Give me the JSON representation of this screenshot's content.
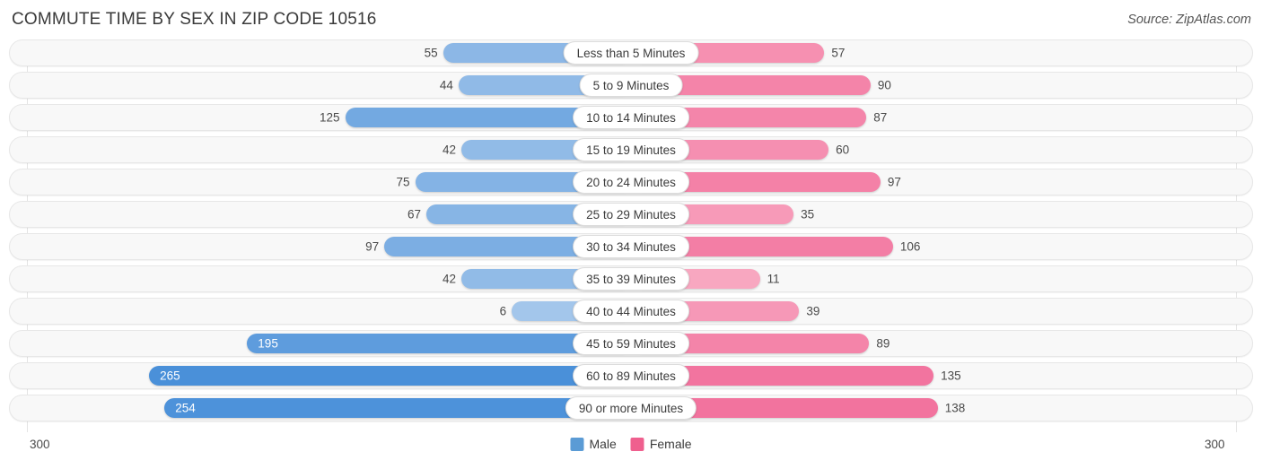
{
  "header": {
    "title": "COMMUTE TIME BY SEX IN ZIP CODE 10516",
    "source": "Source: ZipAtlas.com"
  },
  "legend": {
    "male_label": "Male",
    "female_label": "Female",
    "male_color": "#5b9bd5",
    "female_color": "#ef5f8e"
  },
  "axis": {
    "left_label": "300",
    "right_label": "300",
    "max": 300
  },
  "chart_data": {
    "type": "bar",
    "title": "COMMUTE TIME BY SEX IN ZIP CODE 10516",
    "subtitle": "Source: ZipAtlas.com",
    "orientation": "horizontal-diverging",
    "xlabel": "",
    "ylabel": "",
    "xlim": [
      -300,
      300
    ],
    "grid": true,
    "legend_position": "bottom-center",
    "categories": [
      "Less than 5 Minutes",
      "5 to 9 Minutes",
      "10 to 14 Minutes",
      "15 to 19 Minutes",
      "20 to 24 Minutes",
      "25 to 29 Minutes",
      "30 to 34 Minutes",
      "35 to 39 Minutes",
      "40 to 44 Minutes",
      "45 to 59 Minutes",
      "60 to 89 Minutes",
      "90 or more Minutes"
    ],
    "series": [
      {
        "name": "Male",
        "color": "#5b9bd5",
        "values": [
          55,
          44,
          125,
          42,
          75,
          67,
          97,
          42,
          6,
          195,
          265,
          254
        ]
      },
      {
        "name": "Female",
        "color": "#ef5f8e",
        "values": [
          57,
          90,
          87,
          60,
          97,
          35,
          106,
          11,
          39,
          89,
          135,
          138
        ]
      }
    ]
  },
  "rows": [
    {
      "label": "Less than 5 Minutes",
      "male": "55",
      "female": "57"
    },
    {
      "label": "5 to 9 Minutes",
      "male": "44",
      "female": "90"
    },
    {
      "label": "10 to 14 Minutes",
      "male": "125",
      "female": "87"
    },
    {
      "label": "15 to 19 Minutes",
      "male": "42",
      "female": "60"
    },
    {
      "label": "20 to 24 Minutes",
      "male": "75",
      "female": "97"
    },
    {
      "label": "25 to 29 Minutes",
      "male": "67",
      "female": "35"
    },
    {
      "label": "30 to 34 Minutes",
      "male": "97",
      "female": "106"
    },
    {
      "label": "35 to 39 Minutes",
      "male": "42",
      "female": "11"
    },
    {
      "label": "40 to 44 Minutes",
      "male": "6",
      "female": "39"
    },
    {
      "label": "45 to 59 Minutes",
      "male": "195",
      "female": "89"
    },
    {
      "label": "60 to 89 Minutes",
      "male": "265",
      "female": "135"
    },
    {
      "label": "90 or more Minutes",
      "male": "254",
      "female": "138"
    }
  ]
}
